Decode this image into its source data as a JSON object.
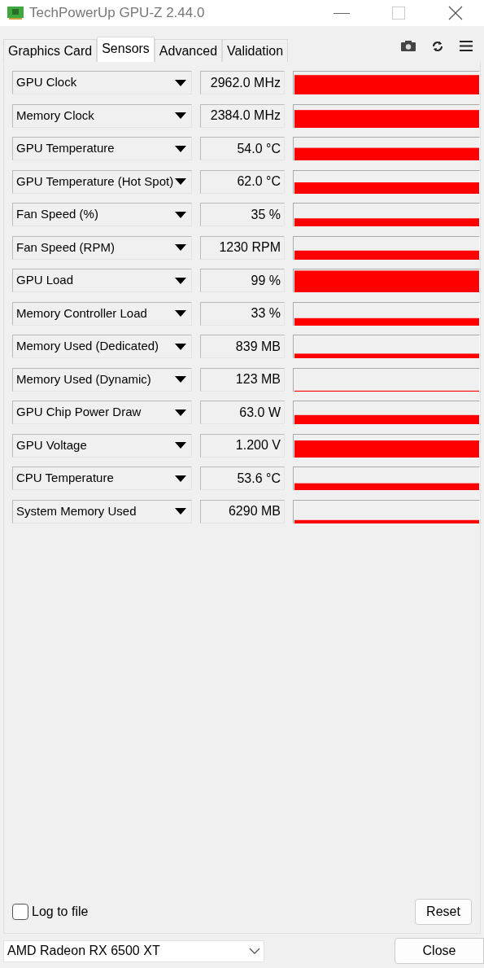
{
  "window": {
    "title": "TechPowerUp GPU-Z 2.44.0"
  },
  "tabs": [
    {
      "label": "Graphics Card",
      "selected": false
    },
    {
      "label": "Sensors",
      "selected": true
    },
    {
      "label": "Advanced",
      "selected": false
    },
    {
      "label": "Validation",
      "selected": false
    }
  ],
  "sensors": [
    {
      "name": "GPU Clock",
      "value": "2962.0 MHz"
    },
    {
      "name": "Memory Clock",
      "value": "2384.0 MHz"
    },
    {
      "name": "GPU Temperature",
      "value": "54.0 °C"
    },
    {
      "name": "GPU Temperature (Hot Spot)",
      "value": "62.0 °C"
    },
    {
      "name": "Fan Speed (%)",
      "value": "35 %"
    },
    {
      "name": "Fan Speed (RPM)",
      "value": "1230 RPM"
    },
    {
      "name": "GPU Load",
      "value": "99 %"
    },
    {
      "name": "Memory Controller Load",
      "value": "33 %"
    },
    {
      "name": "Memory Used (Dedicated)",
      "value": "839 MB"
    },
    {
      "name": "Memory Used (Dynamic)",
      "value": "123 MB"
    },
    {
      "name": "GPU Chip Power Draw",
      "value": "63.0 W"
    },
    {
      "name": "GPU Voltage",
      "value": "1.200 V"
    },
    {
      "name": "CPU Temperature",
      "value": "53.6 °C"
    },
    {
      "name": "System Memory Used",
      "value": "6290 MB"
    }
  ],
  "log_to_file": {
    "label": "Log to file",
    "checked": false
  },
  "reset_button": "Reset",
  "device": {
    "value": "AMD Radeon RX 6500 XT"
  },
  "close_button": "Close"
}
